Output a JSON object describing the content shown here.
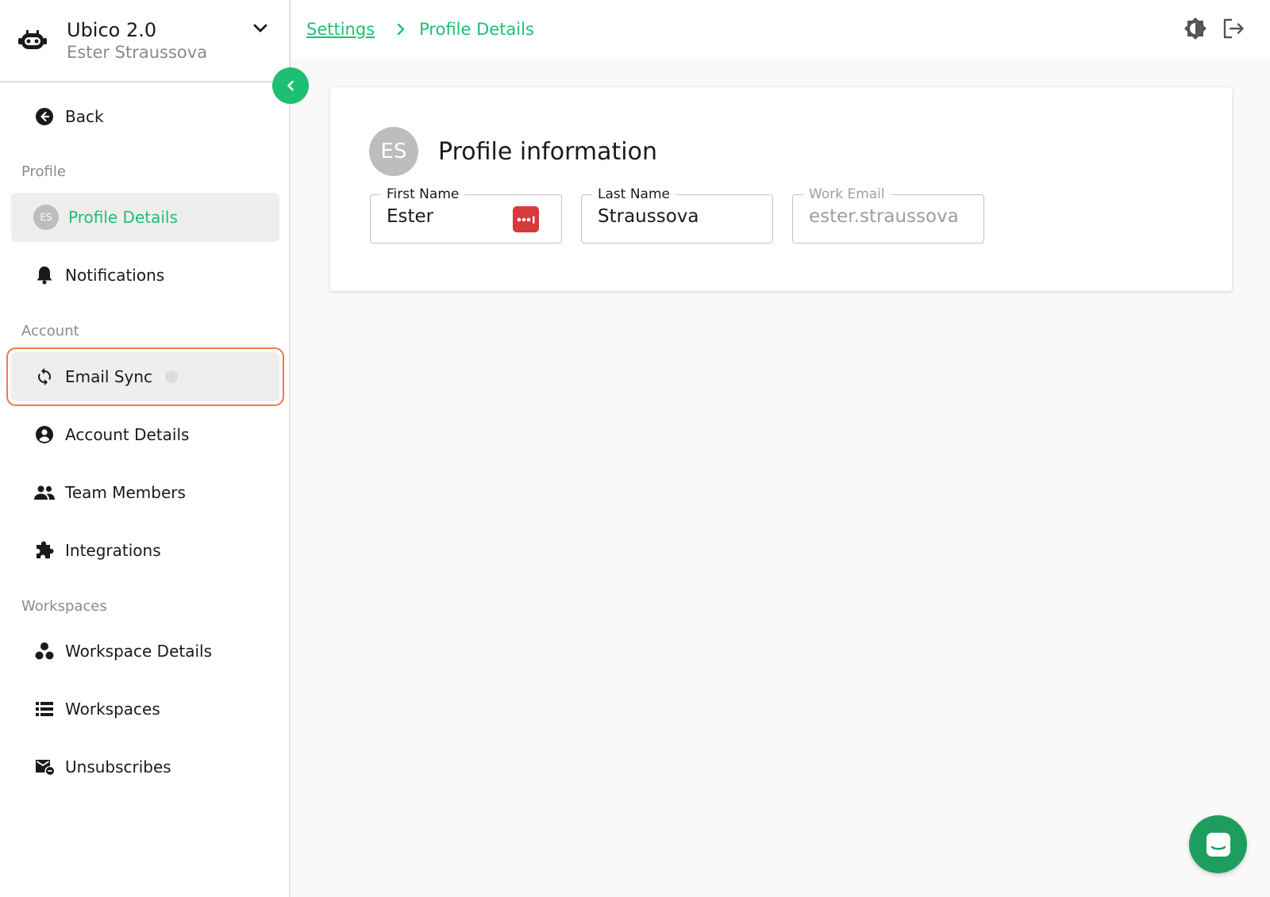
{
  "workspace": {
    "name": "Ubico 2.0",
    "user": "Ester Straussova"
  },
  "sidebar": {
    "back_label": "Back",
    "sections": {
      "profile": "Profile",
      "account": "Account",
      "workspaces": "Workspaces"
    },
    "items": {
      "profile_details": {
        "label": "Profile Details",
        "avatar": "ES"
      },
      "notifications": {
        "label": "Notifications"
      },
      "email_sync": {
        "label": "Email Sync"
      },
      "account_details": {
        "label": "Account Details"
      },
      "team_members": {
        "label": "Team Members"
      },
      "integrations": {
        "label": "Integrations"
      },
      "workspace_details": {
        "label": "Workspace Details"
      },
      "workspaces": {
        "label": "Workspaces"
      },
      "unsubscribes": {
        "label": "Unsubscribes"
      }
    }
  },
  "breadcrumb": {
    "parent": "Settings",
    "current": "Profile Details"
  },
  "card": {
    "title": "Profile information",
    "avatar": "ES",
    "fields": {
      "first_name": {
        "label": "First Name",
        "value": "Ester"
      },
      "last_name": {
        "label": "Last Name",
        "value": "Straussova"
      },
      "work_email": {
        "label": "Work Email",
        "value": "ester.straussova"
      }
    }
  },
  "icons": {
    "logo": "robot-logo-icon",
    "chevron": "chevron-down-icon",
    "collapse": "chevron-left-icon",
    "theme": "brightness-icon",
    "logout": "logout-icon",
    "chat": "chat-icon",
    "password_manager": "password-manager-icon"
  },
  "colors": {
    "accent": "#1dbf73",
    "highlight_border": "#f07a44",
    "chat": "#1e9e5e",
    "password_icon": "#d63a3a"
  }
}
